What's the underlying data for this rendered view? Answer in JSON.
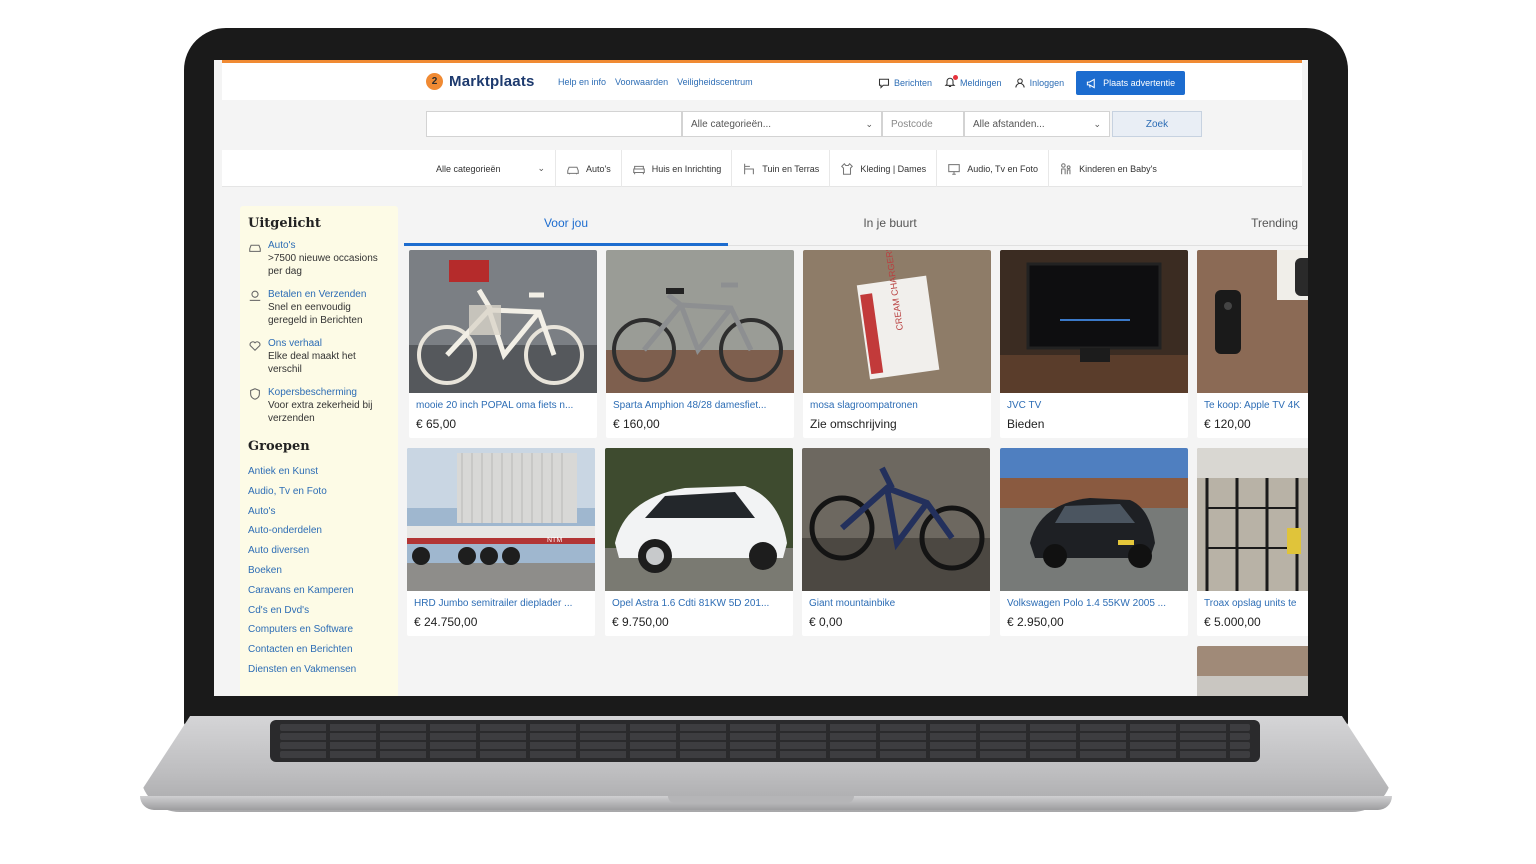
{
  "header": {
    "logo_badge": "2",
    "logo_text": "Marktplaats",
    "links": [
      "Help en info",
      "Voorwaarden",
      "Veiligheidscentrum"
    ],
    "messages_label": "Berichten",
    "notifications_label": "Meldingen",
    "login_label": "Inloggen",
    "place_ad_label": "Plaats advertentie"
  },
  "search": {
    "query_value": "",
    "category_value": "Alle categorieën...",
    "postcode_placeholder": "Postcode",
    "distance_value": "Alle afstanden...",
    "submit_label": "Zoek"
  },
  "categories": {
    "all_label": "Alle categorieën",
    "items": [
      "Auto's",
      "Huis en Inrichting",
      "Tuin en Terras",
      "Kleding | Dames",
      "Audio, Tv en Foto",
      "Kinderen en Baby's"
    ]
  },
  "sidebar": {
    "featured_title": "Uitgelicht",
    "featured": [
      {
        "title": "Auto's",
        "desc": ">7500 nieuwe occasions per dag"
      },
      {
        "title": "Betalen en Verzenden",
        "desc": "Snel en eenvoudig geregeld in Berichten"
      },
      {
        "title": "Ons verhaal",
        "desc": "Elke deal maakt het verschil"
      },
      {
        "title": "Kopersbescherming",
        "desc": "Voor extra zekerheid bij verzenden"
      }
    ],
    "groups_title": "Groepen",
    "groups": [
      "Antiek en Kunst",
      "Audio, Tv en Foto",
      "Auto's",
      "Auto-onderdelen",
      "Auto diversen",
      "Boeken",
      "Caravans en Kamperen",
      "Cd's en Dvd's",
      "Computers en Software",
      "Contacten en Berichten",
      "Diensten en Vakmensen"
    ]
  },
  "tabs": [
    "Voor jou",
    "In je buurt",
    "Trending"
  ],
  "listings": [
    {
      "title": "mooie 20 inch POPAL oma fiets n...",
      "price": "€ 65,00"
    },
    {
      "title": "Sparta Amphion 48/28 damesfiet...",
      "price": "€ 160,00"
    },
    {
      "title": "mosa slagroompatronen",
      "price": "Zie omschrijving"
    },
    {
      "title": "JVC TV",
      "price": "Bieden"
    },
    {
      "title": "Te koop: Apple TV 4K",
      "price": "€ 120,00"
    },
    {
      "title": "HRD Jumbo semitrailer dieplader ...",
      "price": "€ 24.750,00"
    },
    {
      "title": "Opel Astra 1.6 Cdti 81KW 5D 201...",
      "price": "€ 9.750,00"
    },
    {
      "title": "Giant mountainbike",
      "price": "€ 0,00"
    },
    {
      "title": "Volkswagen Polo 1.4 55KW 2005 ...",
      "price": "€ 2.950,00"
    },
    {
      "title": "Troax opslag units te",
      "price": "€ 5.000,00"
    }
  ],
  "image_text": {
    "cream_box": "CREAM CHARGERS",
    "truck_side": "NTM"
  },
  "colors": {
    "brand_orange": "#f08a33",
    "link_blue": "#2d6db5",
    "button_blue": "#1c6ccf",
    "sidebar_bg": "#fdfbe6"
  }
}
